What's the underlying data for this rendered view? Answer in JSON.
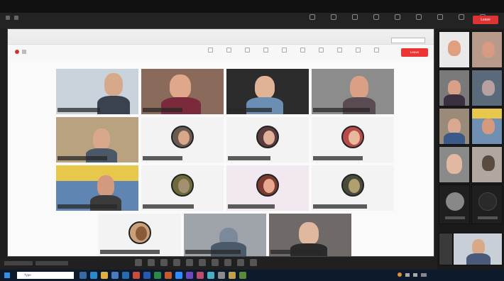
{
  "window": {
    "title": "",
    "leave_label": "Leave"
  },
  "share": {
    "title": "",
    "notice": "",
    "notice_button": "",
    "leave_label": "Leave"
  },
  "taskbar": {
    "search_placeholder": "Type",
    "time": "",
    "date": ""
  },
  "colors": {
    "leave_red": "#dd3333",
    "taskbar": "#0d1a2b",
    "windows_blue": "#3a8de0"
  }
}
